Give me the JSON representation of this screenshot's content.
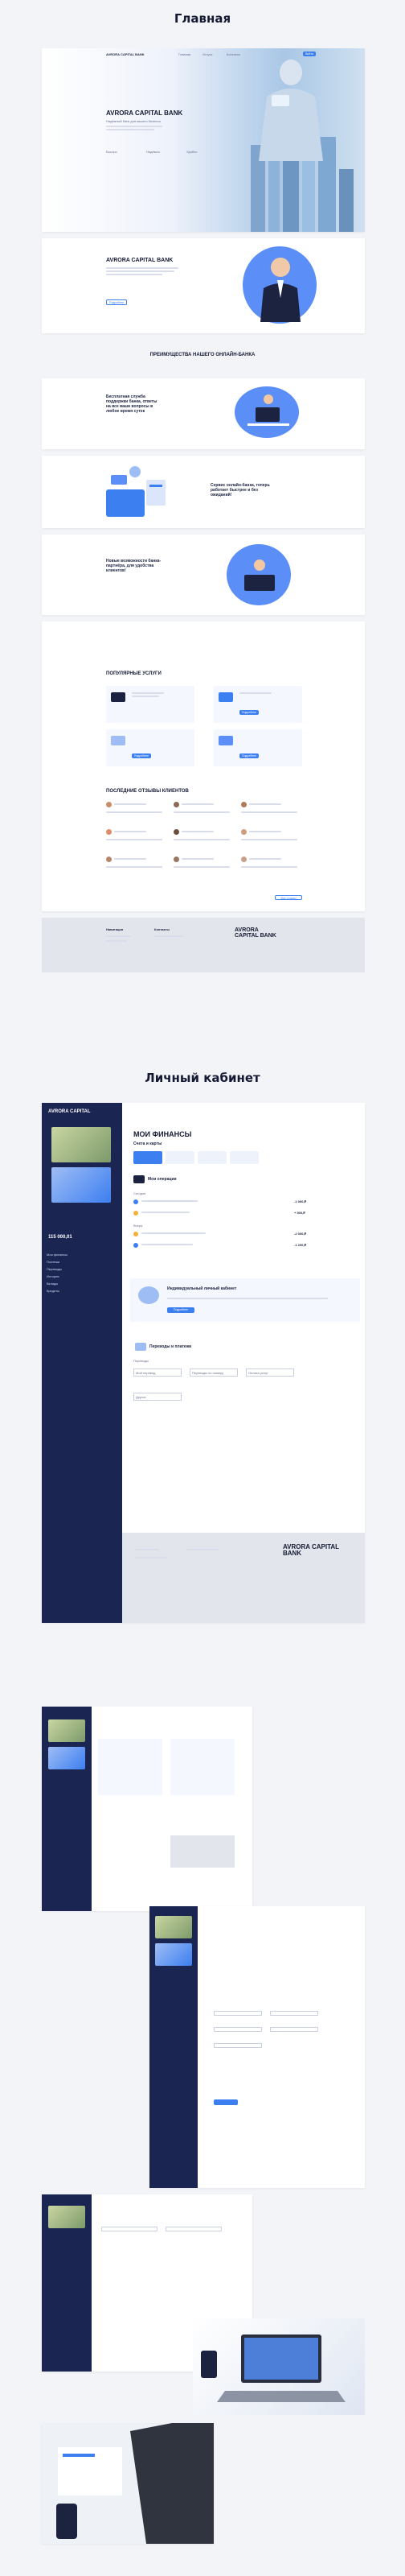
{
  "sections": {
    "home_title": "Главная",
    "cabinet_title": "Личный кабинет"
  },
  "home": {
    "header": {
      "logo": "AVRORA CAPITAL BANK",
      "nav": [
        "Главная",
        "Услуги",
        "Контакты"
      ],
      "login_button": "Войти"
    },
    "hero": {
      "title": "AVRORA CAPITAL BANK",
      "subtitle": "Надёжный банк для вашего бизнеса",
      "features": [
        "Быстро",
        "Надёжно",
        "Удобно"
      ]
    },
    "about": {
      "title": "AVRORA CAPITAL BANK",
      "button": "Подробнее"
    },
    "advantages": {
      "title": "ПРЕИМУЩЕСТВА НАШЕГО ОНЛАЙН-БАНКА",
      "items": [
        "Бесплатная служба поддержки банка, ответы на все ваши вопросы в любое время суток",
        "Сервис онлайн-банка, теперь работает быстрее и без ожиданий!",
        "Новые возможности банка-партнёра, для удобства клиентов!"
      ]
    },
    "services": {
      "title": "ПОПУЛЯРНЫЕ УСЛУГИ",
      "button": "Подробнее"
    },
    "reviews": {
      "title": "ПОСЛЕДНИЕ ОТЗЫВЫ КЛИЕНТОВ",
      "more": "Все отзывы"
    },
    "footer": {
      "logo": "AVRORA CAPITAL BANK",
      "col1": "Навигация",
      "col2": "Контакты"
    }
  },
  "cabinet": {
    "sidebar": {
      "logo": "AVRORA CAPITAL",
      "balance": "115 000,01",
      "items": [
        "Мои финансы",
        "Платежи",
        "Переводы",
        "История",
        "Вклады",
        "Кредиты"
      ]
    },
    "main": {
      "title": "МОИ ФИНАНСЫ",
      "accounts_label": "Счета и карты",
      "operations_title": "Мои операции",
      "today": "Сегодня",
      "yesterday": "Вчера",
      "promo_title": "Индивидуальный личный кабинет",
      "promo_button": "Подробнее",
      "transfers_title": "Переводы и платежи",
      "transfers_label": "Переводы",
      "transfer_items": [
        "Мой перевод",
        "Переводы по номеру",
        "Оплата услуг",
        "Другое"
      ],
      "amounts": [
        "-1 000,₽",
        "+ 500,₽",
        "-2 000,₽",
        "-1 200,₽"
      ]
    },
    "footer": {
      "logo": "AVRORA CAPITAL BANK"
    }
  },
  "colors": {
    "accent": "#3c7ff0",
    "navy": "#1b2552",
    "background": "#f3f4f8"
  }
}
